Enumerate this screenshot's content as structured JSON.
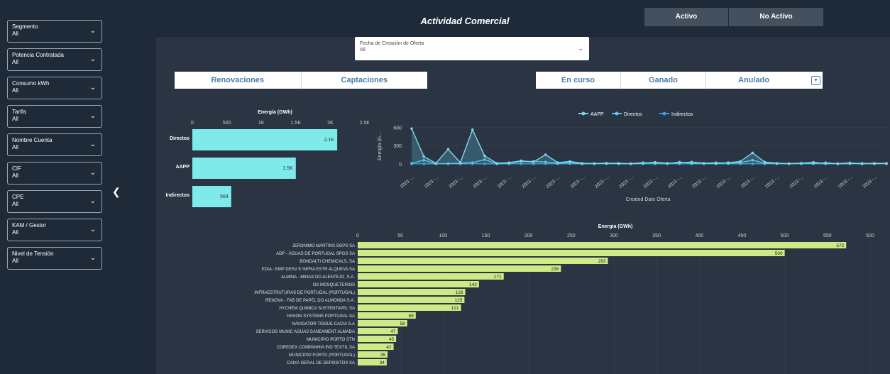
{
  "sidebar": {
    "filters": [
      {
        "label": "Segmento",
        "value": "All"
      },
      {
        "label": "Potencia Contratada",
        "value": "All"
      },
      {
        "label": "Consumo kWh",
        "value": "All"
      },
      {
        "label": "Tarifa",
        "value": "All"
      },
      {
        "label": "Nombre Cuenta",
        "value": "All"
      },
      {
        "label": "CIF",
        "value": "All"
      },
      {
        "label": "CPE",
        "value": "All"
      },
      {
        "label": "KAM / Gestor",
        "value": "All"
      },
      {
        "label": "Nivel de Tensión",
        "value": "All"
      }
    ],
    "collapse_icon": "chevron-left-icon"
  },
  "header": {
    "title": "Actividad Comercial",
    "toggle_active": "Activo",
    "toggle_inactive": "No Activo"
  },
  "date_slicer": {
    "label": "Fecha de Creación de Oferta",
    "value": "All"
  },
  "type_buttons": [
    "Renovaciones",
    "Captaciones"
  ],
  "status_buttons": [
    "En curso",
    "Ganado",
    "Anulado"
  ],
  "colors": {
    "cyan_bar": "#7eeaea",
    "green_bar": "#cdea86",
    "line_aapp": "#7ad8e8",
    "line_directos": "#5ec6e6",
    "line_indirectos": "#3aa0e0"
  },
  "chart_data": [
    {
      "type": "bar",
      "orientation": "horizontal",
      "title": "Energía (GWh)",
      "categories": [
        "Directos",
        "AAPP",
        "Indirectos"
      ],
      "values": [
        2100,
        1500,
        564
      ],
      "value_labels": [
        "2.1K",
        "1.5K",
        "564"
      ],
      "x_ticks": [
        "0",
        "500",
        "1K",
        "1.5K",
        "2K",
        "2.5K"
      ],
      "xlim": [
        0,
        2500
      ]
    },
    {
      "type": "line",
      "title": "",
      "legend": [
        "AAPP",
        "Directos",
        "Indirectos"
      ],
      "legend_position": "top",
      "xlabel": "Created Date Oferta",
      "ylabel": "Energía (G...",
      "y_ticks": [
        "0",
        "300",
        "600"
      ],
      "ylim": [
        -60,
        640
      ],
      "x_tick_label": "2023 -...",
      "series": [
        {
          "name": "AAPP",
          "values": [
            580,
            120,
            10,
            240,
            20,
            560,
            130,
            10,
            20,
            50,
            30,
            150,
            20,
            40,
            10,
            5,
            10,
            5,
            0,
            10,
            25,
            10,
            15,
            30,
            10,
            5,
            20,
            40,
            180,
            30,
            10,
            5,
            10,
            25,
            5,
            5,
            15,
            0,
            10,
            5
          ]
        },
        {
          "name": "Directos",
          "values": [
            10,
            60,
            0,
            5,
            10,
            20,
            70,
            0,
            10,
            40,
            40,
            30,
            10,
            20,
            0,
            5,
            10,
            10,
            5,
            20,
            10,
            5,
            30,
            5,
            10,
            20,
            10,
            20,
            60,
            10,
            5,
            0,
            10,
            5,
            20,
            0,
            5,
            10,
            0,
            10
          ]
        },
        {
          "name": "Indirectos",
          "values": [
            0,
            0,
            0,
            0,
            0,
            0,
            0,
            0,
            0,
            0,
            0,
            0,
            0,
            0,
            0,
            0,
            0,
            0,
            0,
            0,
            0,
            0,
            0,
            0,
            0,
            0,
            0,
            0,
            0,
            0,
            0,
            0,
            0,
            0,
            0,
            0,
            0,
            0,
            0,
            0
          ]
        }
      ]
    },
    {
      "type": "bar",
      "orientation": "horizontal",
      "title": "Energía (GWh)",
      "x_ticks": [
        "0",
        "50",
        "100",
        "150",
        "200",
        "250",
        "300",
        "350",
        "400",
        "450",
        "500",
        "550",
        "600"
      ],
      "xlim": [
        0,
        615
      ],
      "categories": [
        "JERONIMO MARTINS SGPS SA",
        "ADP - ÁGUAS DE PORTUGAL SPGS SA",
        "BONDALTI CHEMICALS, SA",
        "EDIA - EMP DESV E INFRA ESTR ALQUEVA SA",
        "ALMINA - MINAS DO ALENTEJO, S.A.",
        "OS MOSQUETEIROS",
        "INFRAESTRUTURAS DE PORTUGAL (PORTUGAL)",
        "RENOVA - FAB DE PAPEL DO ALMONDA S.A.",
        "HYCHEM QUIMICA SUSTENTAVEL SA",
        "HANON SYSTEMS PORTUGAL SA",
        "NAVIGATOR TISSUE CACIA S.A",
        "SERVICOS MUNIC AGUAS SANEAMENT ALMADA",
        "MUNICIPIO PORTO STN",
        "COREDEX COMPANHIA IND TEXTIL SA",
        "MUNICIPIO PORTO (PORTUGAL)",
        "CAIXA GERAL DE DEPOSITOS SA"
      ],
      "values": [
        572,
        500,
        293,
        238,
        171,
        142,
        126,
        125,
        121,
        68,
        58,
        47,
        45,
        42,
        35,
        34
      ]
    }
  ]
}
